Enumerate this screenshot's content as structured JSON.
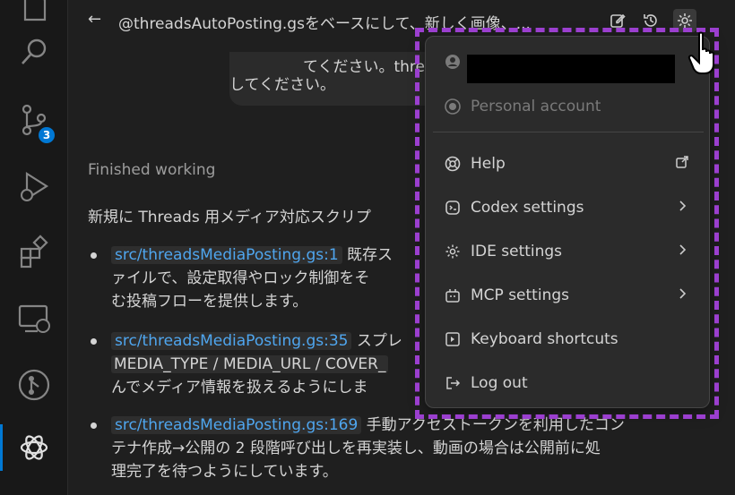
{
  "activity_bar": {
    "items": [
      {
        "name": "explorer-icon"
      },
      {
        "name": "search-icon"
      },
      {
        "name": "source-control-icon",
        "badge": "3"
      },
      {
        "name": "run-debug-icon"
      },
      {
        "name": "extensions-icon"
      },
      {
        "name": "remote-explorer-icon"
      },
      {
        "name": "git-graph-icon"
      },
      {
        "name": "openai-codex-icon",
        "active": true
      }
    ]
  },
  "header": {
    "back_icon": "←",
    "title": "@threadsAutoPosting.gsをベースにして、新しく画像、...",
    "icons": [
      "edit-icon",
      "history-icon",
      "gear-icon"
    ]
  },
  "chat": {
    "user_bubble_line1": "てください。threads",
    "user_bubble_line2": "してください。",
    "status": "Finished working",
    "intro": "新規に Threads 用メディア対応スクリプ",
    "bullets": [
      {
        "code": "src/threadsMediaPosting.gs:1",
        "text_after_code": " 既存ス",
        "line2": "ァイルで、設定取得やロック制御をそ",
        "line3": "む投稿フローを提供します。"
      },
      {
        "code": "src/threadsMediaPosting.gs:35",
        "text_after_code": " スプレ",
        "line2_code": "MEDIA_TYPE / MEDIA_URL / COVER_",
        "line3": "んでメディア情報を扱えるようにしま"
      },
      {
        "code": "src/threadsMediaPosting.gs:169",
        "text_after_code": " 手動アクセストークンを利用したコン",
        "line2": "テナ作成→公開の 2 段階呼び出しを再実装し、動画の場合は公開前に処",
        "line3": "理完了を待つようにしています。"
      }
    ]
  },
  "menu": {
    "account_icon": "user-icon",
    "personal_account": "Personal account",
    "items": [
      {
        "icon": "help-icon",
        "label": "Help",
        "trailing": "external-link-icon"
      },
      {
        "icon": "codex-icon",
        "label": "Codex settings",
        "trailing": "chevron-right-icon"
      },
      {
        "icon": "gear-icon",
        "label": "IDE settings",
        "trailing": "chevron-right-icon"
      },
      {
        "icon": "mcp-icon",
        "label": "MCP settings",
        "trailing": "chevron-right-icon"
      },
      {
        "icon": "keyboard-icon",
        "label": "Keyboard shortcuts",
        "trailing": ""
      },
      {
        "icon": "logout-icon",
        "label": "Log out",
        "trailing": ""
      }
    ]
  },
  "colors": {
    "highlight": "#9b3fcf",
    "link": "#4fa6ef",
    "accent": "#0078d4"
  }
}
